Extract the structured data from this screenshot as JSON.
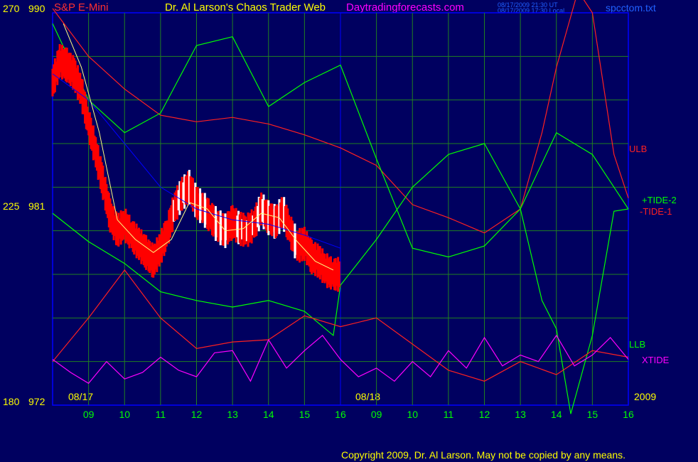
{
  "header": {
    "instrument": "S&P E-Mini",
    "title": "Dr. Al Larson's Chaos Trader Web",
    "site": "Daytradingforecasts.com",
    "file": "spcctom.txt",
    "timestamp_1": "08/17/2009 21:30 UT",
    "timestamp_2": "08/17/2009 17:30 Local"
  },
  "footer": {
    "copyright": "Copyright 2009, Dr. Al Larson. May not be copied by any means."
  },
  "colors": {
    "background": "#000060",
    "grid": "#208020",
    "price": "#ff0000",
    "price_up": "#ffffff",
    "tide1": "#ff2020",
    "tide2": "#00ff00",
    "xtide": "#ff00ff",
    "ma_blue": "#0000ff",
    "ma_yellow": "#ffff80"
  },
  "chart_data": {
    "type": "line",
    "y_left_outer": {
      "ticks": [
        "270",
        "225",
        "180"
      ]
    },
    "y_left_inner": {
      "ticks": [
        "990",
        "981",
        "972"
      ]
    },
    "day_labels": [
      "08/17",
      "08/18",
      "2009"
    ],
    "x_ticks": [
      "09",
      "10",
      "11",
      "12",
      "13",
      "14",
      "15",
      "16",
      "09",
      "10",
      "11",
      "12",
      "13",
      "14",
      "15",
      "16"
    ],
    "series_labels": {
      "ulb": "ULB",
      "llb": "LLB",
      "tide2": "+TIDE-2",
      "tide1": "-TIDE-1",
      "xtide": "XTIDE"
    },
    "x_unit": "hour index (0 = 08:00 on 08/17, 8.0 = 16:00 on 08/17, 8.0–16.0 = 08/18 09:00–16:00)",
    "ylim": [
      972,
      990
    ],
    "price_close": [
      [
        0,
        986.8
      ],
      [
        0.2,
        987.8
      ],
      [
        0.4,
        987.6
      ],
      [
        0.6,
        987.2
      ],
      [
        0.8,
        986.4
      ],
      [
        1.0,
        984.9
      ],
      [
        1.2,
        983.6
      ],
      [
        1.4,
        982.2
      ],
      [
        1.6,
        980.7
      ],
      [
        1.8,
        980.0
      ],
      [
        2.0,
        980.3
      ],
      [
        2.2,
        979.8
      ],
      [
        2.4,
        979.4
      ],
      [
        2.6,
        979.0
      ],
      [
        2.8,
        978.6
      ],
      [
        3.0,
        979.2
      ],
      [
        3.2,
        980.0
      ],
      [
        3.4,
        981.1
      ],
      [
        3.6,
        981.7
      ],
      [
        3.8,
        982.0
      ],
      [
        4.0,
        981.3
      ],
      [
        4.2,
        981.0
      ],
      [
        4.4,
        980.6
      ],
      [
        4.6,
        980.2
      ],
      [
        4.8,
        980.0
      ],
      [
        5.0,
        980.4
      ],
      [
        5.2,
        980.1
      ],
      [
        5.4,
        980.0
      ],
      [
        5.6,
        980.3
      ],
      [
        5.8,
        981.0
      ],
      [
        6.0,
        980.6
      ],
      [
        6.2,
        980.4
      ],
      [
        6.4,
        980.9
      ],
      [
        6.6,
        980.0
      ],
      [
        6.8,
        979.3
      ],
      [
        7.0,
        979.4
      ],
      [
        7.2,
        978.8
      ],
      [
        7.4,
        978.6
      ],
      [
        7.6,
        978.2
      ],
      [
        7.8,
        978.0
      ],
      [
        8.0,
        978.0
      ]
    ],
    "ma_blue": [
      [
        0,
        987.2
      ],
      [
        1.0,
        986.0
      ],
      [
        2.0,
        984.0
      ],
      [
        3.0,
        982.0
      ],
      [
        4.0,
        981.0
      ],
      [
        5.0,
        980.5
      ],
      [
        6.0,
        980.3
      ],
      [
        7.0,
        979.8
      ],
      [
        8.0,
        979.2
      ]
    ],
    "ma_yellow": [
      [
        0.3,
        989.5
      ],
      [
        0.8,
        987.5
      ],
      [
        1.3,
        984.5
      ],
      [
        1.8,
        980.5
      ],
      [
        2.3,
        979.6
      ],
      [
        2.8,
        979.0
      ],
      [
        3.3,
        979.6
      ],
      [
        3.8,
        981.3
      ],
      [
        4.3,
        981.0
      ],
      [
        4.8,
        980.0
      ],
      [
        5.3,
        980.1
      ],
      [
        5.8,
        980.8
      ],
      [
        6.3,
        980.6
      ],
      [
        6.8,
        979.5
      ],
      [
        7.3,
        978.6
      ],
      [
        7.8,
        978.2
      ]
    ],
    "series": [
      {
        "name": "ULB",
        "color": "#ff2020",
        "values": [
          [
            0,
            990.2
          ],
          [
            1.0,
            988.0
          ],
          [
            2.0,
            986.5
          ],
          [
            3.0,
            985.3
          ],
          [
            4.0,
            985.0
          ],
          [
            5.0,
            985.2
          ],
          [
            6.0,
            984.9
          ],
          [
            7.0,
            984.4
          ],
          [
            8.0,
            983.8
          ],
          [
            9.0,
            983.0
          ],
          [
            10.0,
            981.2
          ],
          [
            11.0,
            980.6
          ],
          [
            12.0,
            979.9
          ],
          [
            13.0,
            981.0
          ],
          [
            13.6,
            984.5
          ],
          [
            14.0,
            987.5
          ],
          [
            14.6,
            991.0
          ],
          [
            15.0,
            990.0
          ],
          [
            15.6,
            983.5
          ],
          [
            16.0,
            981.5
          ]
        ]
      },
      {
        "name": "LLB",
        "color": "#00ff00",
        "values": [
          [
            0,
            980.8
          ],
          [
            1.0,
            979.5
          ],
          [
            2.0,
            978.5
          ],
          [
            3.0,
            977.2
          ],
          [
            4.0,
            976.8
          ],
          [
            5.0,
            976.5
          ],
          [
            6.0,
            976.8
          ],
          [
            7.0,
            976.3
          ],
          [
            7.8,
            975.2
          ],
          [
            8.0,
            977.5
          ],
          [
            9.0,
            979.6
          ],
          [
            10.0,
            982.0
          ],
          [
            11.0,
            983.5
          ],
          [
            12.0,
            984.0
          ],
          [
            13.0,
            981.0
          ],
          [
            13.6,
            976.8
          ],
          [
            14.0,
            975.5
          ],
          [
            14.4,
            971.6
          ],
          [
            15.0,
            975.2
          ],
          [
            15.6,
            980.9
          ],
          [
            16.0,
            981.0
          ]
        ]
      },
      {
        "name": "+TIDE-2",
        "color": "#00ff00",
        "values": [
          [
            0,
            989.5
          ],
          [
            1.0,
            986.0
          ],
          [
            2.0,
            984.5
          ],
          [
            3.0,
            985.4
          ],
          [
            4.0,
            988.5
          ],
          [
            5.0,
            988.9
          ],
          [
            6.0,
            985.7
          ],
          [
            7.0,
            986.8
          ],
          [
            8.0,
            987.6
          ],
          [
            9.0,
            983.3
          ],
          [
            10.0,
            979.2
          ],
          [
            11.0,
            978.8
          ],
          [
            12.0,
            979.3
          ],
          [
            13.0,
            981.0
          ],
          [
            14.0,
            984.5
          ],
          [
            15.0,
            983.5
          ],
          [
            16.0,
            981.0
          ]
        ]
      },
      {
        "name": "-TIDE-1",
        "color": "#ff2020",
        "values": [
          [
            0,
            974.0
          ],
          [
            1.0,
            976.0
          ],
          [
            2.0,
            978.2
          ],
          [
            3.0,
            976.0
          ],
          [
            4.0,
            974.6
          ],
          [
            5.0,
            974.9
          ],
          [
            6.0,
            975.0
          ],
          [
            7.0,
            976.1
          ],
          [
            8.0,
            975.6
          ],
          [
            9.0,
            976.0
          ],
          [
            10.0,
            974.8
          ],
          [
            11.0,
            973.6
          ],
          [
            12.0,
            973.1
          ],
          [
            13.0,
            974.0
          ],
          [
            14.0,
            973.4
          ],
          [
            15.0,
            974.5
          ],
          [
            16.0,
            974.2
          ]
        ]
      },
      {
        "name": "XTIDE",
        "color": "#ff00ff",
        "values": [
          [
            0,
            974.1
          ],
          [
            0.5,
            973.5
          ],
          [
            1.0,
            973.0
          ],
          [
            1.5,
            974.0
          ],
          [
            2.0,
            973.2
          ],
          [
            2.5,
            973.5
          ],
          [
            3.0,
            974.2
          ],
          [
            3.5,
            973.6
          ],
          [
            4.0,
            973.3
          ],
          [
            4.5,
            974.4
          ],
          [
            5.0,
            974.5
          ],
          [
            5.5,
            973.1
          ],
          [
            6.0,
            975.0
          ],
          [
            6.5,
            973.7
          ],
          [
            7.0,
            974.5
          ],
          [
            7.5,
            975.2
          ],
          [
            8.0,
            974.1
          ],
          [
            8.5,
            973.3
          ],
          [
            9.0,
            973.7
          ],
          [
            9.5,
            973.1
          ],
          [
            10.0,
            974.0
          ],
          [
            10.5,
            973.3
          ],
          [
            11.0,
            974.5
          ],
          [
            11.5,
            973.7
          ],
          [
            12.0,
            975.1
          ],
          [
            12.5,
            973.8
          ],
          [
            13.0,
            974.3
          ],
          [
            13.5,
            974.0
          ],
          [
            14.0,
            975.2
          ],
          [
            14.5,
            973.8
          ],
          [
            15.0,
            974.3
          ],
          [
            15.5,
            975.1
          ],
          [
            16.0,
            974.1
          ]
        ]
      }
    ]
  }
}
